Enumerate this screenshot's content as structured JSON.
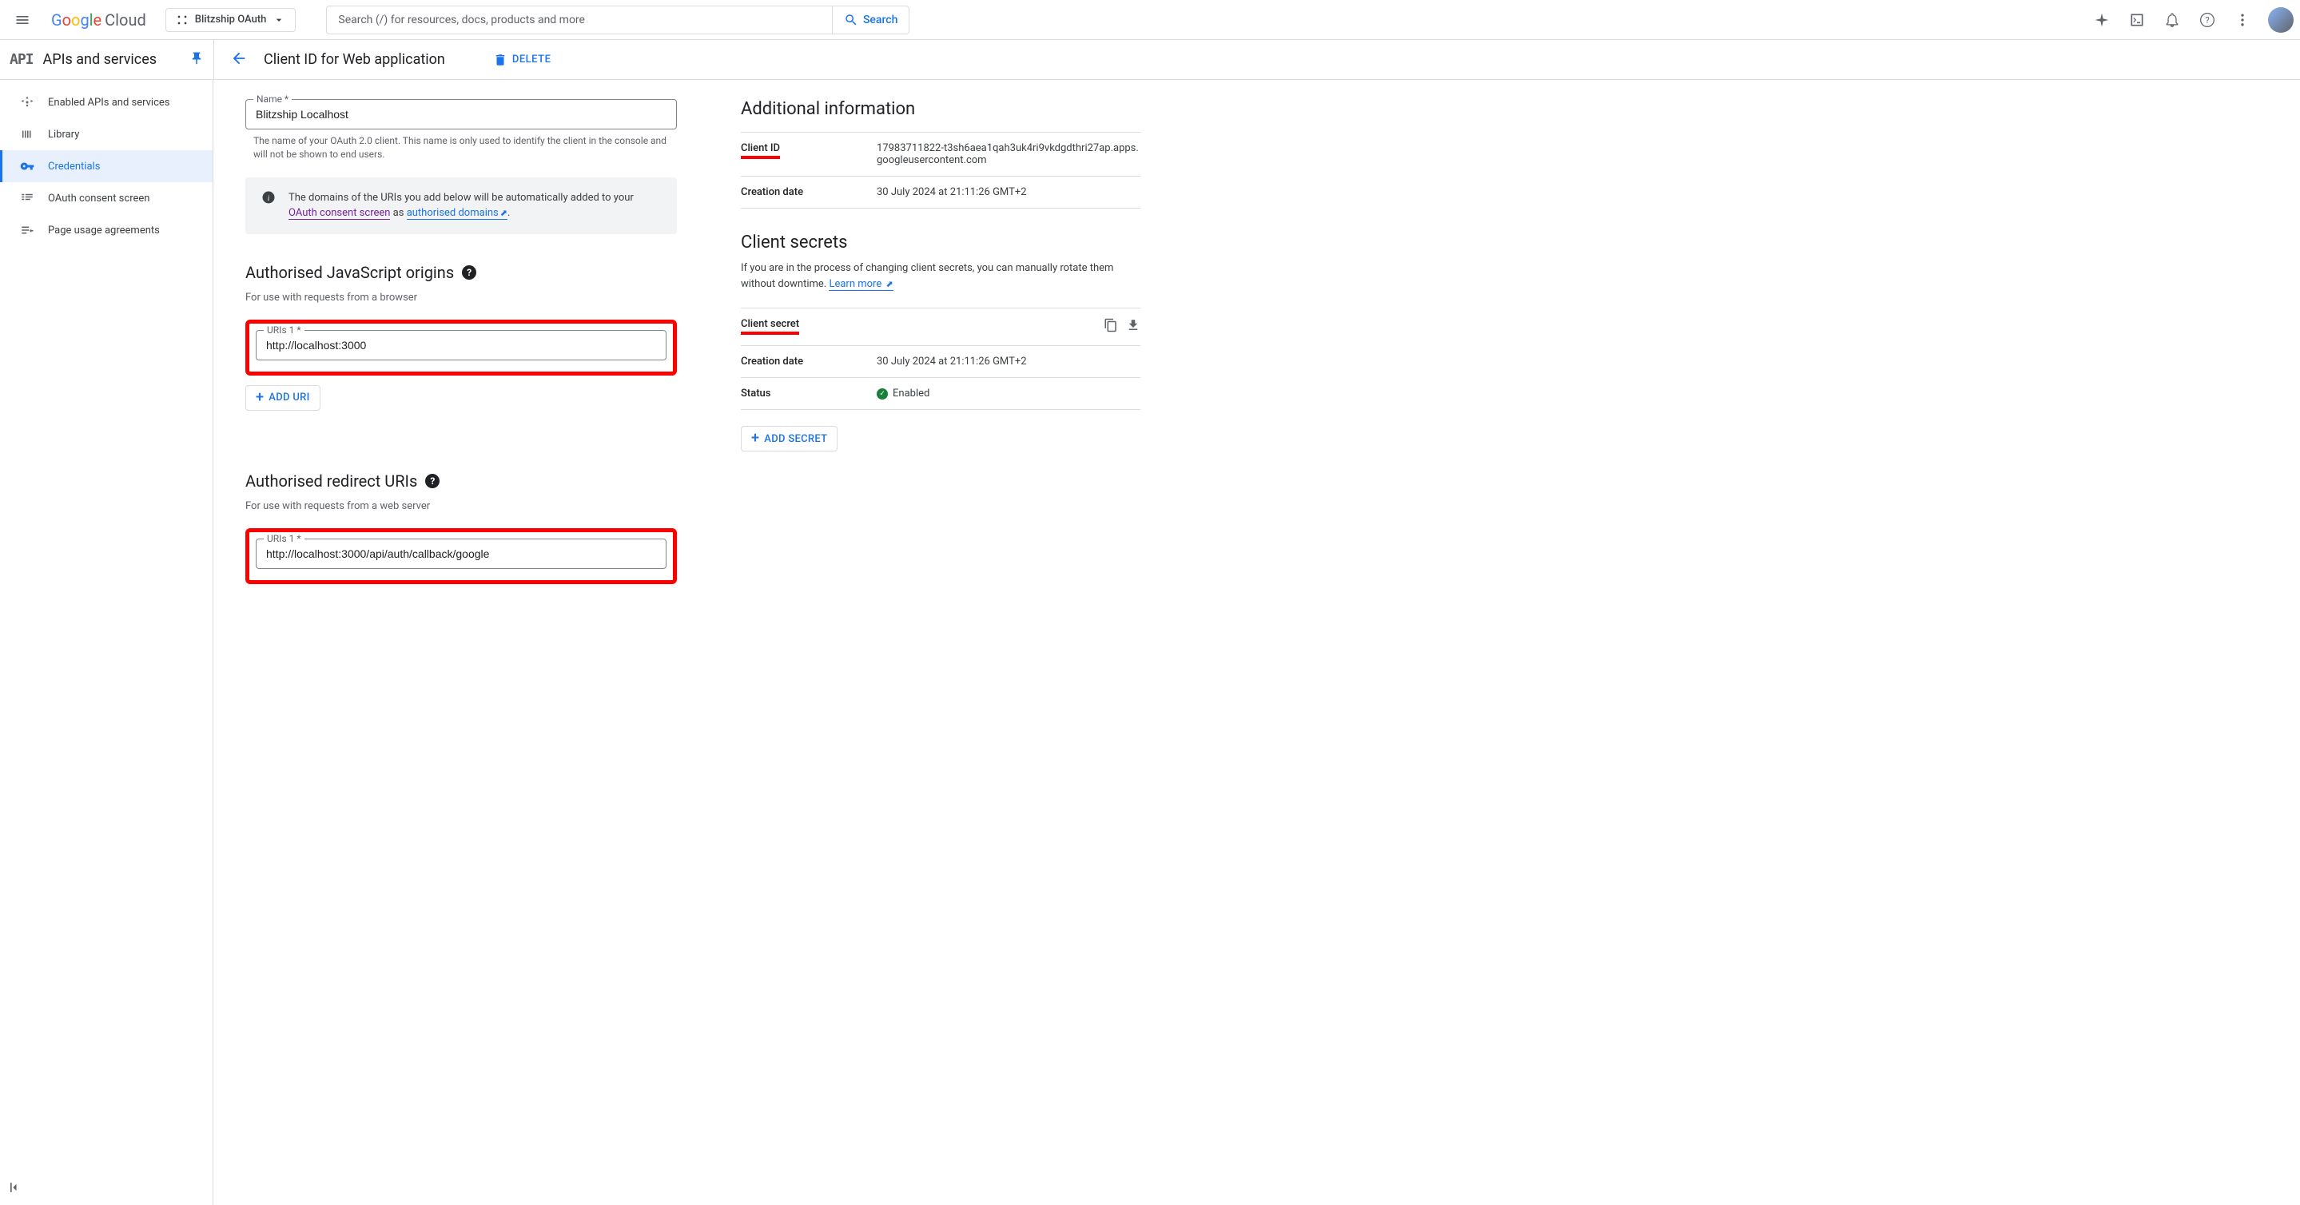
{
  "header": {
    "brand_cloud": "Cloud",
    "project_name": "Blitzship OAuth",
    "search_placeholder": "Search (/) for resources, docs, products and more",
    "search_button": "Search"
  },
  "subheader": {
    "api_label": "API",
    "section_title": "APIs and services",
    "page_title": "Client ID for Web application",
    "delete_label": "DELETE"
  },
  "sidebar": [
    {
      "label": "Enabled APIs and services",
      "active": false
    },
    {
      "label": "Library",
      "active": false
    },
    {
      "label": "Credentials",
      "active": true
    },
    {
      "label": "OAuth consent screen",
      "active": false
    },
    {
      "label": "Page usage agreements",
      "active": false
    }
  ],
  "form": {
    "name_label": "Name *",
    "name_value": "Blitzship Localhost",
    "name_help": "The name of your OAuth 2.0 client. This name is only used to identify the client in the console and will not be shown to end users.",
    "infobox_prefix": "The domains of the URIs you add below will be automatically added to your ",
    "infobox_link1": "OAuth consent screen",
    "infobox_mid": " as ",
    "infobox_link2": "authorised domains",
    "js_origins_title": "Authorised JavaScript origins",
    "js_origins_help": "For use with requests from a browser",
    "js_uri_label": "URIs 1 *",
    "js_uri_value": "http://localhost:3000",
    "add_uri_label": "ADD URI",
    "redirect_title": "Authorised redirect URIs",
    "redirect_help": "For use with requests from a web server",
    "redirect_uri_label": "URIs 1 *",
    "redirect_uri_value": "http://localhost:3000/api/auth/callback/google"
  },
  "info": {
    "heading": "Additional information",
    "client_id_label": "Client ID",
    "client_id_value": "17983711822-t3sh6aea1qah3uk4ri9vkdgdthri27ap.apps.googleusercontent.com",
    "creation_label": "Creation date",
    "creation_value": "30 July 2024 at 21:11:26 GMT+2",
    "secrets_heading": "Client secrets",
    "secrets_help_text": "If you are in the process of changing client secrets, you can manually rotate them without downtime. ",
    "secrets_learn_more": "Learn more",
    "secret_label": "Client secret",
    "secret_creation_label": "Creation date",
    "secret_creation_value": "30 July 2024 at 21:11:26 GMT+2",
    "status_label": "Status",
    "status_value": "Enabled",
    "add_secret_label": "ADD SECRET"
  }
}
